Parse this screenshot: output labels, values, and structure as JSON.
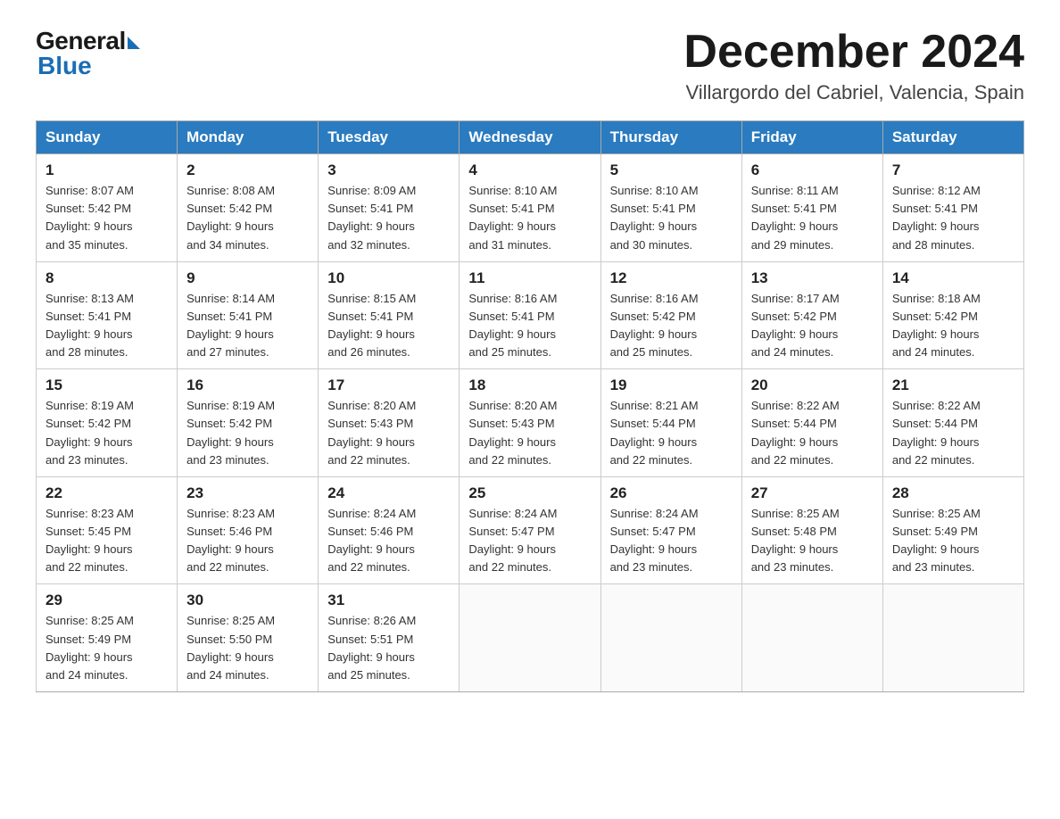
{
  "header": {
    "logo_general": "General",
    "logo_blue": "Blue",
    "title": "December 2024",
    "location": "Villargordo del Cabriel, Valencia, Spain"
  },
  "days_of_week": [
    "Sunday",
    "Monday",
    "Tuesday",
    "Wednesday",
    "Thursday",
    "Friday",
    "Saturday"
  ],
  "weeks": [
    [
      {
        "day": "1",
        "sunrise": "8:07 AM",
        "sunset": "5:42 PM",
        "daylight": "9 hours and 35 minutes."
      },
      {
        "day": "2",
        "sunrise": "8:08 AM",
        "sunset": "5:42 PM",
        "daylight": "9 hours and 34 minutes."
      },
      {
        "day": "3",
        "sunrise": "8:09 AM",
        "sunset": "5:41 PM",
        "daylight": "9 hours and 32 minutes."
      },
      {
        "day": "4",
        "sunrise": "8:10 AM",
        "sunset": "5:41 PM",
        "daylight": "9 hours and 31 minutes."
      },
      {
        "day": "5",
        "sunrise": "8:10 AM",
        "sunset": "5:41 PM",
        "daylight": "9 hours and 30 minutes."
      },
      {
        "day": "6",
        "sunrise": "8:11 AM",
        "sunset": "5:41 PM",
        "daylight": "9 hours and 29 minutes."
      },
      {
        "day": "7",
        "sunrise": "8:12 AM",
        "sunset": "5:41 PM",
        "daylight": "9 hours and 28 minutes."
      }
    ],
    [
      {
        "day": "8",
        "sunrise": "8:13 AM",
        "sunset": "5:41 PM",
        "daylight": "9 hours and 28 minutes."
      },
      {
        "day": "9",
        "sunrise": "8:14 AM",
        "sunset": "5:41 PM",
        "daylight": "9 hours and 27 minutes."
      },
      {
        "day": "10",
        "sunrise": "8:15 AM",
        "sunset": "5:41 PM",
        "daylight": "9 hours and 26 minutes."
      },
      {
        "day": "11",
        "sunrise": "8:16 AM",
        "sunset": "5:41 PM",
        "daylight": "9 hours and 25 minutes."
      },
      {
        "day": "12",
        "sunrise": "8:16 AM",
        "sunset": "5:42 PM",
        "daylight": "9 hours and 25 minutes."
      },
      {
        "day": "13",
        "sunrise": "8:17 AM",
        "sunset": "5:42 PM",
        "daylight": "9 hours and 24 minutes."
      },
      {
        "day": "14",
        "sunrise": "8:18 AM",
        "sunset": "5:42 PM",
        "daylight": "9 hours and 24 minutes."
      }
    ],
    [
      {
        "day": "15",
        "sunrise": "8:19 AM",
        "sunset": "5:42 PM",
        "daylight": "9 hours and 23 minutes."
      },
      {
        "day": "16",
        "sunrise": "8:19 AM",
        "sunset": "5:42 PM",
        "daylight": "9 hours and 23 minutes."
      },
      {
        "day": "17",
        "sunrise": "8:20 AM",
        "sunset": "5:43 PM",
        "daylight": "9 hours and 22 minutes."
      },
      {
        "day": "18",
        "sunrise": "8:20 AM",
        "sunset": "5:43 PM",
        "daylight": "9 hours and 22 minutes."
      },
      {
        "day": "19",
        "sunrise": "8:21 AM",
        "sunset": "5:44 PM",
        "daylight": "9 hours and 22 minutes."
      },
      {
        "day": "20",
        "sunrise": "8:22 AM",
        "sunset": "5:44 PM",
        "daylight": "9 hours and 22 minutes."
      },
      {
        "day": "21",
        "sunrise": "8:22 AM",
        "sunset": "5:44 PM",
        "daylight": "9 hours and 22 minutes."
      }
    ],
    [
      {
        "day": "22",
        "sunrise": "8:23 AM",
        "sunset": "5:45 PM",
        "daylight": "9 hours and 22 minutes."
      },
      {
        "day": "23",
        "sunrise": "8:23 AM",
        "sunset": "5:46 PM",
        "daylight": "9 hours and 22 minutes."
      },
      {
        "day": "24",
        "sunrise": "8:24 AM",
        "sunset": "5:46 PM",
        "daylight": "9 hours and 22 minutes."
      },
      {
        "day": "25",
        "sunrise": "8:24 AM",
        "sunset": "5:47 PM",
        "daylight": "9 hours and 22 minutes."
      },
      {
        "day": "26",
        "sunrise": "8:24 AM",
        "sunset": "5:47 PM",
        "daylight": "9 hours and 23 minutes."
      },
      {
        "day": "27",
        "sunrise": "8:25 AM",
        "sunset": "5:48 PM",
        "daylight": "9 hours and 23 minutes."
      },
      {
        "day": "28",
        "sunrise": "8:25 AM",
        "sunset": "5:49 PM",
        "daylight": "9 hours and 23 minutes."
      }
    ],
    [
      {
        "day": "29",
        "sunrise": "8:25 AM",
        "sunset": "5:49 PM",
        "daylight": "9 hours and 24 minutes."
      },
      {
        "day": "30",
        "sunrise": "8:25 AM",
        "sunset": "5:50 PM",
        "daylight": "9 hours and 24 minutes."
      },
      {
        "day": "31",
        "sunrise": "8:26 AM",
        "sunset": "5:51 PM",
        "daylight": "9 hours and 25 minutes."
      },
      null,
      null,
      null,
      null
    ]
  ],
  "labels": {
    "sunrise": "Sunrise:",
    "sunset": "Sunset:",
    "daylight": "Daylight:"
  }
}
